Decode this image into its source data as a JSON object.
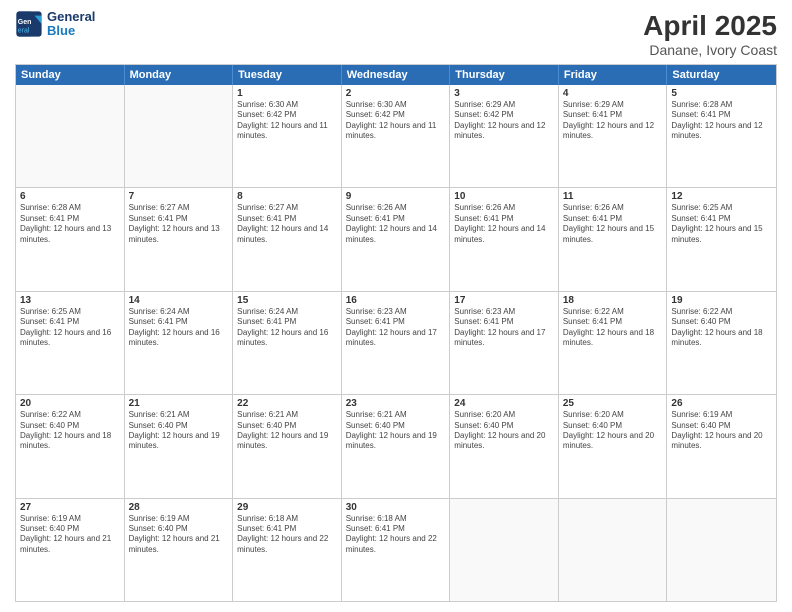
{
  "header": {
    "logo": {
      "text_line1": "General",
      "text_line2": "Blue"
    },
    "title": "April 2025",
    "subtitle": "Danane, Ivory Coast"
  },
  "calendar": {
    "days_of_week": [
      "Sunday",
      "Monday",
      "Tuesday",
      "Wednesday",
      "Thursday",
      "Friday",
      "Saturday"
    ],
    "rows": [
      [
        {
          "day": "",
          "info": ""
        },
        {
          "day": "",
          "info": ""
        },
        {
          "day": "1",
          "info": "Sunrise: 6:30 AM\nSunset: 6:42 PM\nDaylight: 12 hours and 11 minutes."
        },
        {
          "day": "2",
          "info": "Sunrise: 6:30 AM\nSunset: 6:42 PM\nDaylight: 12 hours and 11 minutes."
        },
        {
          "day": "3",
          "info": "Sunrise: 6:29 AM\nSunset: 6:42 PM\nDaylight: 12 hours and 12 minutes."
        },
        {
          "day": "4",
          "info": "Sunrise: 6:29 AM\nSunset: 6:41 PM\nDaylight: 12 hours and 12 minutes."
        },
        {
          "day": "5",
          "info": "Sunrise: 6:28 AM\nSunset: 6:41 PM\nDaylight: 12 hours and 12 minutes."
        }
      ],
      [
        {
          "day": "6",
          "info": "Sunrise: 6:28 AM\nSunset: 6:41 PM\nDaylight: 12 hours and 13 minutes."
        },
        {
          "day": "7",
          "info": "Sunrise: 6:27 AM\nSunset: 6:41 PM\nDaylight: 12 hours and 13 minutes."
        },
        {
          "day": "8",
          "info": "Sunrise: 6:27 AM\nSunset: 6:41 PM\nDaylight: 12 hours and 14 minutes."
        },
        {
          "day": "9",
          "info": "Sunrise: 6:26 AM\nSunset: 6:41 PM\nDaylight: 12 hours and 14 minutes."
        },
        {
          "day": "10",
          "info": "Sunrise: 6:26 AM\nSunset: 6:41 PM\nDaylight: 12 hours and 14 minutes."
        },
        {
          "day": "11",
          "info": "Sunrise: 6:26 AM\nSunset: 6:41 PM\nDaylight: 12 hours and 15 minutes."
        },
        {
          "day": "12",
          "info": "Sunrise: 6:25 AM\nSunset: 6:41 PM\nDaylight: 12 hours and 15 minutes."
        }
      ],
      [
        {
          "day": "13",
          "info": "Sunrise: 6:25 AM\nSunset: 6:41 PM\nDaylight: 12 hours and 16 minutes."
        },
        {
          "day": "14",
          "info": "Sunrise: 6:24 AM\nSunset: 6:41 PM\nDaylight: 12 hours and 16 minutes."
        },
        {
          "day": "15",
          "info": "Sunrise: 6:24 AM\nSunset: 6:41 PM\nDaylight: 12 hours and 16 minutes."
        },
        {
          "day": "16",
          "info": "Sunrise: 6:23 AM\nSunset: 6:41 PM\nDaylight: 12 hours and 17 minutes."
        },
        {
          "day": "17",
          "info": "Sunrise: 6:23 AM\nSunset: 6:41 PM\nDaylight: 12 hours and 17 minutes."
        },
        {
          "day": "18",
          "info": "Sunrise: 6:22 AM\nSunset: 6:41 PM\nDaylight: 12 hours and 18 minutes."
        },
        {
          "day": "19",
          "info": "Sunrise: 6:22 AM\nSunset: 6:40 PM\nDaylight: 12 hours and 18 minutes."
        }
      ],
      [
        {
          "day": "20",
          "info": "Sunrise: 6:22 AM\nSunset: 6:40 PM\nDaylight: 12 hours and 18 minutes."
        },
        {
          "day": "21",
          "info": "Sunrise: 6:21 AM\nSunset: 6:40 PM\nDaylight: 12 hours and 19 minutes."
        },
        {
          "day": "22",
          "info": "Sunrise: 6:21 AM\nSunset: 6:40 PM\nDaylight: 12 hours and 19 minutes."
        },
        {
          "day": "23",
          "info": "Sunrise: 6:21 AM\nSunset: 6:40 PM\nDaylight: 12 hours and 19 minutes."
        },
        {
          "day": "24",
          "info": "Sunrise: 6:20 AM\nSunset: 6:40 PM\nDaylight: 12 hours and 20 minutes."
        },
        {
          "day": "25",
          "info": "Sunrise: 6:20 AM\nSunset: 6:40 PM\nDaylight: 12 hours and 20 minutes."
        },
        {
          "day": "26",
          "info": "Sunrise: 6:19 AM\nSunset: 6:40 PM\nDaylight: 12 hours and 20 minutes."
        }
      ],
      [
        {
          "day": "27",
          "info": "Sunrise: 6:19 AM\nSunset: 6:40 PM\nDaylight: 12 hours and 21 minutes."
        },
        {
          "day": "28",
          "info": "Sunrise: 6:19 AM\nSunset: 6:40 PM\nDaylight: 12 hours and 21 minutes."
        },
        {
          "day": "29",
          "info": "Sunrise: 6:18 AM\nSunset: 6:41 PM\nDaylight: 12 hours and 22 minutes."
        },
        {
          "day": "30",
          "info": "Sunrise: 6:18 AM\nSunset: 6:41 PM\nDaylight: 12 hours and 22 minutes."
        },
        {
          "day": "",
          "info": ""
        },
        {
          "day": "",
          "info": ""
        },
        {
          "day": "",
          "info": ""
        }
      ]
    ]
  }
}
